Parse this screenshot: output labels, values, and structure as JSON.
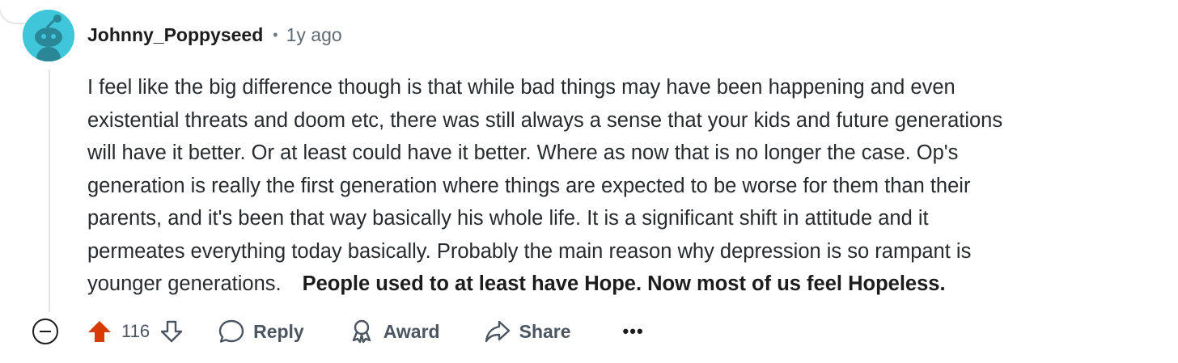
{
  "comment": {
    "author": "Johnny_Poppyseed",
    "separator": "•",
    "time_ago": "1y ago",
    "body_lines": [
      "I feel like the big difference though is that while bad things may have been happening and even",
      "existential threats and doom etc, there was still always a sense that your kids and future generations",
      "will have it better. Or at least could have it better. Where as now that is no longer the case. Op's",
      "generation is really the first generation where things are expected to be worse for them than their",
      "parents, and it's been that way basically his whole life. It is a significant shift in attitude and it",
      "permeates everything today basically. Probably the main reason why depression is so rampant is",
      "younger generations."
    ],
    "body_bold": "People used to at least have Hope. Now most of us feel Hopeless."
  },
  "actions": {
    "score": "116",
    "reply_label": "Reply",
    "award_label": "Award",
    "share_label": "Share",
    "more_label": "•••"
  },
  "colors": {
    "avatar_bg": "#3fc6da",
    "upvote_active": "#d93a00",
    "text": "#272b2e",
    "meta": "#5e6b75"
  },
  "icons": [
    "collapse-icon",
    "upvote-icon",
    "downvote-icon",
    "reply-icon",
    "award-icon",
    "share-icon",
    "more-icon"
  ]
}
